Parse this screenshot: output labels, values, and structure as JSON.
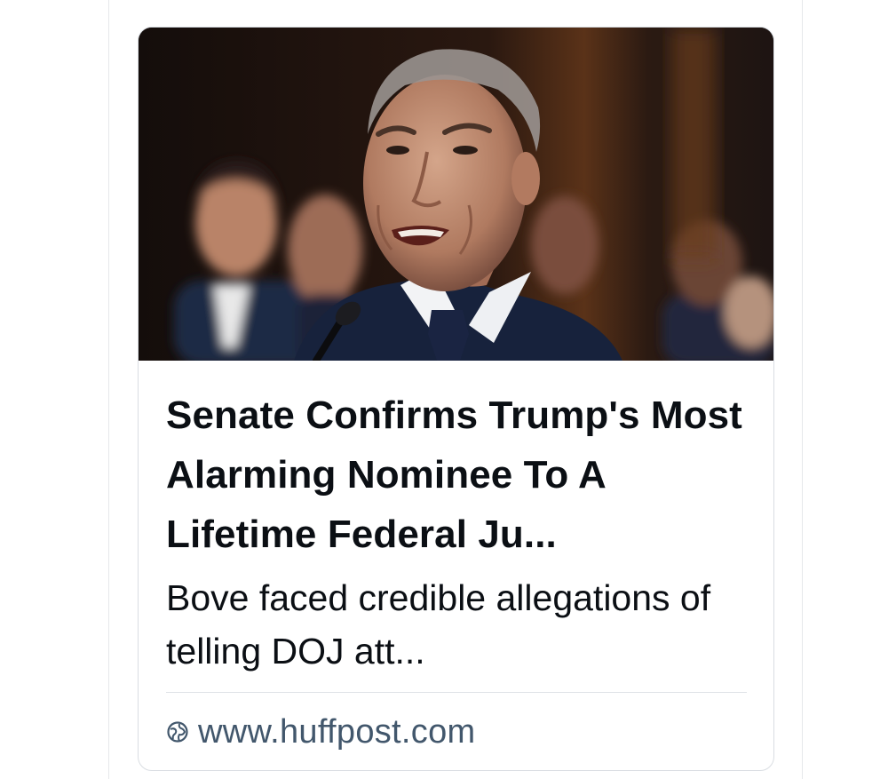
{
  "card": {
    "title": "Senate Confirms Trump's Most Alarming Nominee To A Lifetime Federal Ju...",
    "description": "Bove faced credible allegations of telling DOJ att...",
    "source": {
      "icon": "globe-icon",
      "domain": "www.huffpost.com"
    },
    "thumbnail": {
      "subject": "photo-man-in-dark-suit-speaking-at-microphone"
    }
  },
  "colors": {
    "text_primary": "#0b0f14",
    "text_secondary": "#42576c",
    "border": "#d9dde2",
    "divider": "#dfe3e7"
  }
}
